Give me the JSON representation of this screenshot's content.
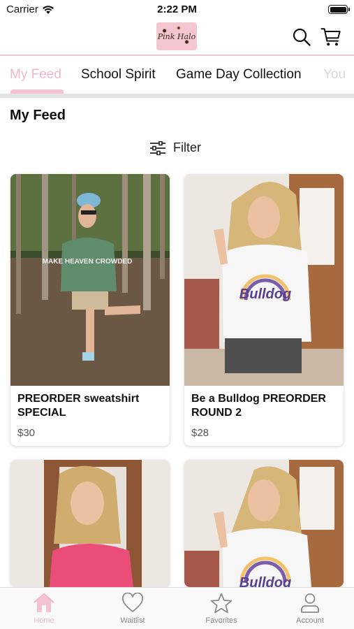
{
  "status_bar": {
    "carrier": "Carrier",
    "time": "2:22 PM"
  },
  "header": {
    "logo_text": "Pink Halo",
    "icons": [
      "search-icon",
      "cart-icon"
    ]
  },
  "tabs": [
    {
      "label": "My Feed",
      "active": true
    },
    {
      "label": "School Spirit",
      "active": false
    },
    {
      "label": "Game Day Collection",
      "active": false
    },
    {
      "label": "You",
      "active": false
    }
  ],
  "feed": {
    "title": "My Feed",
    "filter_label": "Filter",
    "products": [
      {
        "name": "PREORDER sweatshirt SPECIAL",
        "price": "$30",
        "shirt_text": "MAKE HEAVEN CROWDED"
      },
      {
        "name": "Be a Bulldog PREORDER ROUND 2",
        "price": "$28",
        "shirt_text": "Bulldog"
      },
      {
        "name": "",
        "price": ""
      },
      {
        "name": "",
        "price": "",
        "shirt_text": "Bulldog"
      }
    ]
  },
  "bottom_nav": [
    {
      "label": "Home",
      "icon": "home-icon",
      "active": true
    },
    {
      "label": "Waitlist",
      "icon": "heart-icon",
      "active": false
    },
    {
      "label": "Favorites",
      "icon": "star-icon",
      "active": false
    },
    {
      "label": "Account",
      "icon": "person-icon",
      "active": false
    }
  ],
  "colors": {
    "accent": "#f1b8c9",
    "indicator": "#f4c3d1",
    "divider": "#e3e3e3"
  }
}
